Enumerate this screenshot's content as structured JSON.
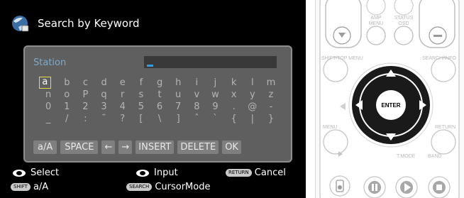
{
  "screen": {
    "title": "Search by Keyword",
    "field_label": "Station",
    "keyboard_rows": [
      [
        "a",
        "b",
        "c",
        "d",
        "e",
        "f",
        "g",
        "h",
        "i",
        "j",
        "k",
        "l",
        "m"
      ],
      [
        "n",
        "o",
        "P",
        "q",
        "r",
        "s",
        "t",
        "u",
        "v",
        "w",
        "x",
        "y",
        "z"
      ],
      [
        "0",
        "1",
        "2",
        "3",
        "4",
        "5",
        "6",
        "7",
        "8",
        "9",
        ".",
        "@",
        "-"
      ],
      [
        "_",
        "/",
        ":",
        "˜",
        "?",
        "[",
        "\\",
        "]",
        "ˆ",
        "`",
        "{",
        "|",
        "}"
      ]
    ],
    "selected_key": "a",
    "function_keys": [
      "a/A",
      "SPACE",
      "←",
      "→",
      "INSERT",
      "DELETE",
      "OK"
    ],
    "legend": {
      "select_label": "Select",
      "input_label": "Input",
      "cancel_pill": "RETURN",
      "cancel_label": "Cancel",
      "shift_pill": "SHIFT",
      "shift_label": "a/A",
      "search_pill": "SEARCH",
      "cursor_label": "CursorMode"
    }
  },
  "remote": {
    "amp_menu_label": "AMP MENU",
    "status_label": "STATUS",
    "osd_label": "OSD",
    "shift_top_menu_label": "SHIFT/TOP MENU",
    "search_info_label": "SEARCH/INFO",
    "enter_label": "ENTER",
    "menu_label": "MENU",
    "return_label": "RETURN",
    "tmode_label": "T.MODE",
    "band_label": "BAND"
  }
}
